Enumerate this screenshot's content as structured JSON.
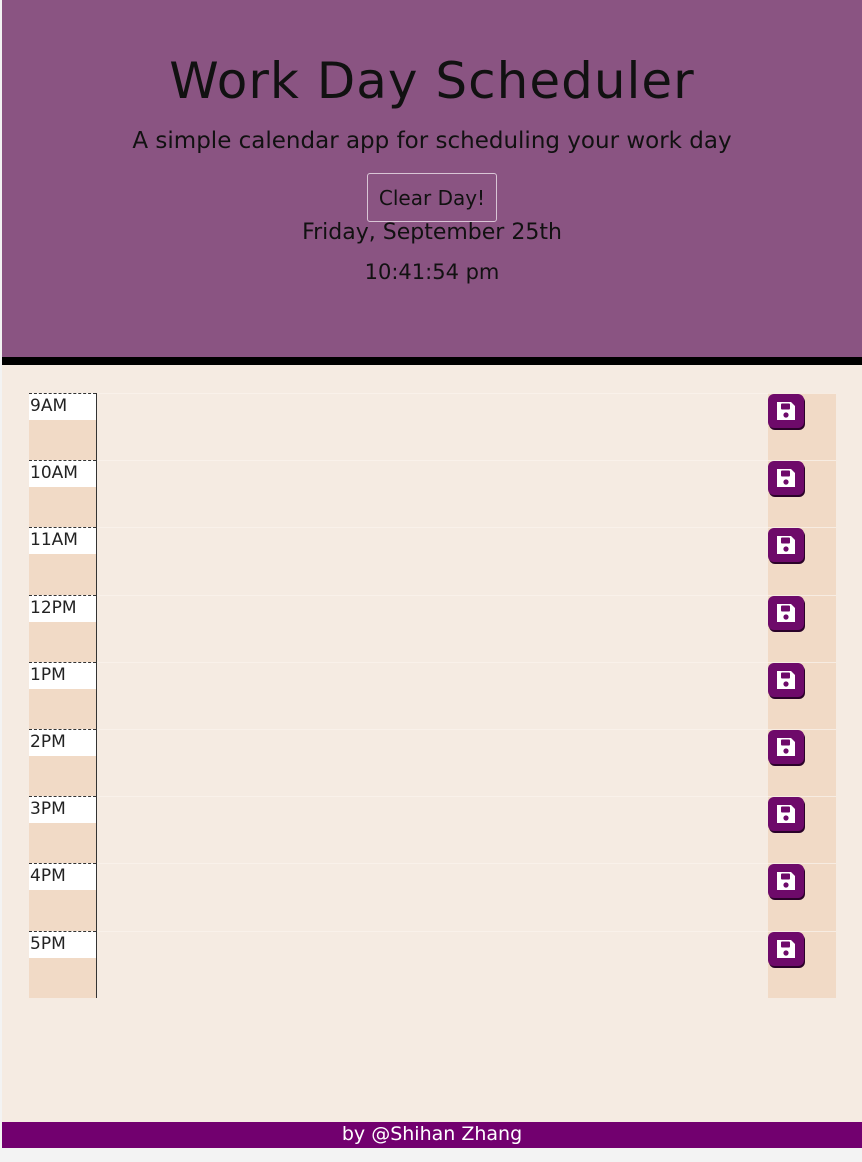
{
  "header": {
    "title": "Work Day Scheduler",
    "subtitle": "A simple calendar app for scheduling your work day",
    "clear_button": "Clear Day!",
    "date": "Friday, September 25th",
    "time": "10:41:54 pm"
  },
  "schedule": {
    "hours": [
      {
        "label": "9AM",
        "text": ""
      },
      {
        "label": "10AM",
        "text": ""
      },
      {
        "label": "11AM",
        "text": ""
      },
      {
        "label": "12PM",
        "text": ""
      },
      {
        "label": "1PM",
        "text": ""
      },
      {
        "label": "2PM",
        "text": ""
      },
      {
        "label": "3PM",
        "text": ""
      },
      {
        "label": "4PM",
        "text": ""
      },
      {
        "label": "5PM",
        "text": ""
      }
    ],
    "save_icon": "floppy-disk-icon"
  },
  "footer": {
    "credit": "by @Shihan Zhang"
  },
  "colors": {
    "header_bg": "#8a5482",
    "page_bg": "#f5ebe2",
    "hour_bg": "#f1dac6",
    "save_button": "#6e0a6a",
    "footer_bg": "#72006f"
  }
}
